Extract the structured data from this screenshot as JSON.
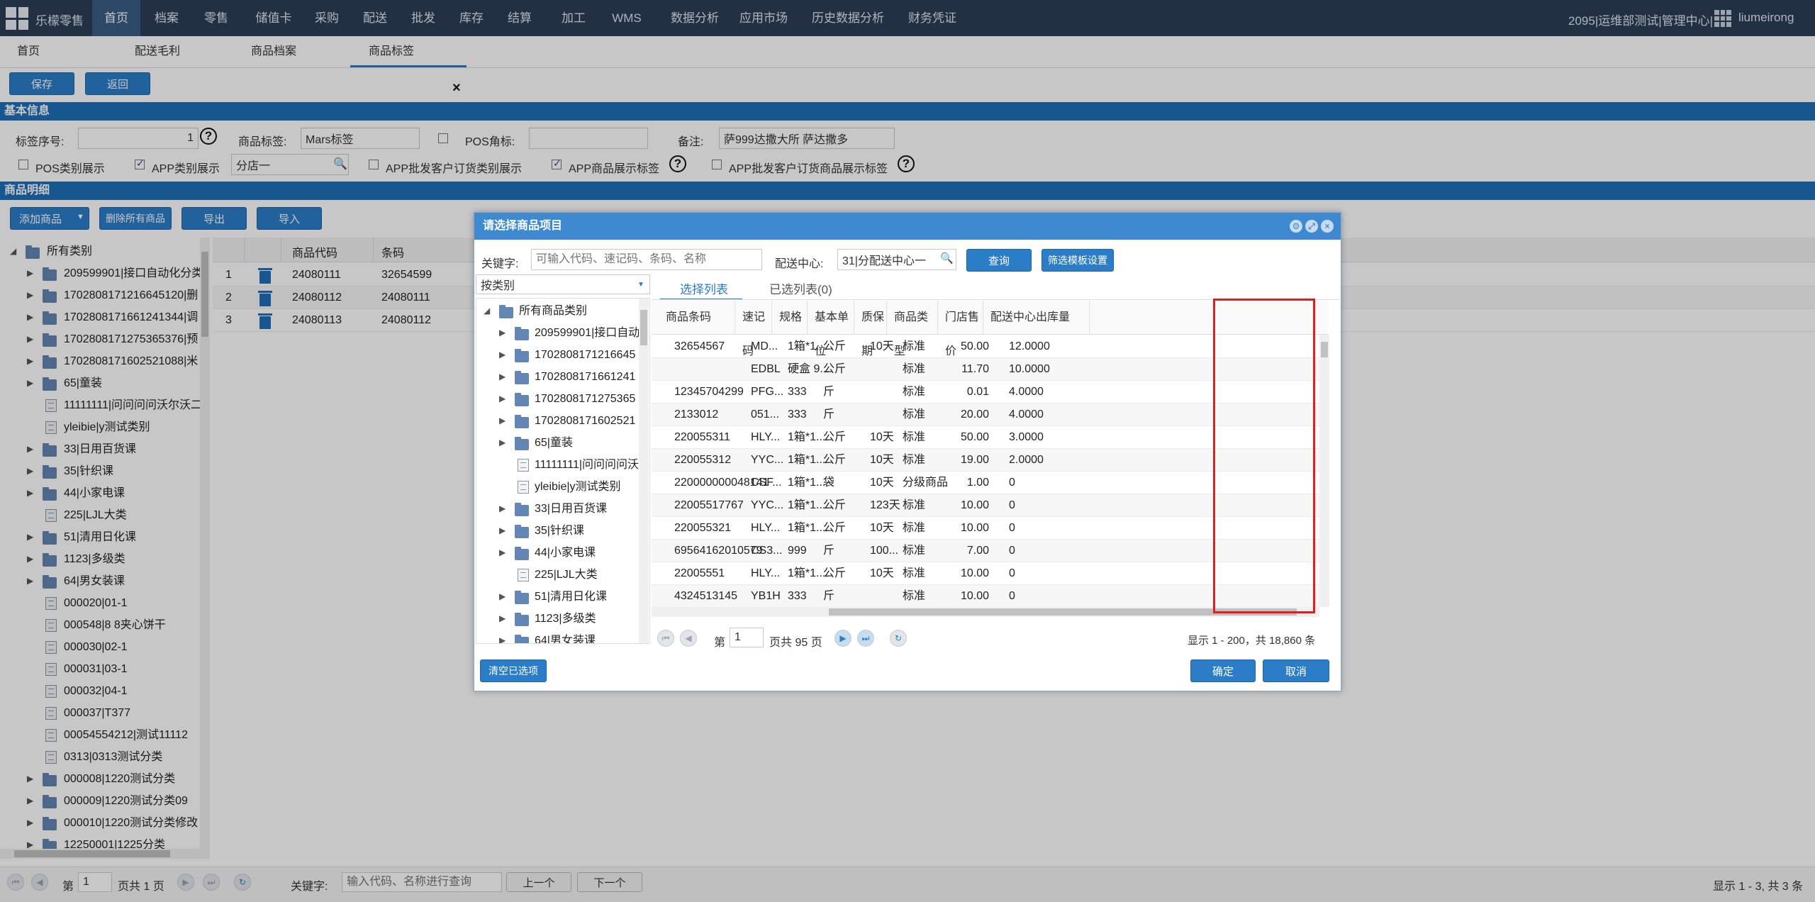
{
  "app": {
    "name": "乐檬零售"
  },
  "nav": [
    "首页",
    "档案",
    "零售",
    "储值卡",
    "采购",
    "配送",
    "批发",
    "库存",
    "结算",
    "加工",
    "WMS",
    "数据分析",
    "应用市场",
    "历史数据分析",
    "财务凭证"
  ],
  "top_right": {
    "org": "2095|运维部测试|管理中心|",
    "user": "liumeirong"
  },
  "tabs": [
    "首页",
    "配送毛利",
    "商品档案",
    "商品标签"
  ],
  "toolbar": {
    "save": "保存",
    "back": "返回"
  },
  "basic_info": {
    "title": "基本信息",
    "seq_label": "标签序号:",
    "seq_value": "1",
    "tag_label": "商品标签:",
    "tag_value": "Mars标签",
    "pos_corner_label": "POS角标:",
    "remark_label": "备注:",
    "remark_value": "萨999达撒大所 萨达撒多",
    "pos_cat_show": "POS类别展示",
    "app_cat_show": "APP类别展示",
    "branch_value": "分店一",
    "app_wholesale_cat": "APP批发客户订货类别展示",
    "app_goods_tag": "APP商品展示标签",
    "app_wholesale_goods_tag": "APP批发客户订货商品展示标签"
  },
  "detail": {
    "title": "商品明细",
    "add": "添加商品",
    "delete_all": "删除所有商品",
    "export": "导出",
    "import": "导入",
    "columns": [
      "商品代码",
      "条码"
    ],
    "rows": [
      {
        "no": "1",
        "code": "24080111",
        "barcode": "32654599"
      },
      {
        "no": "2",
        "code": "24080112",
        "barcode": "24080111"
      },
      {
        "no": "3",
        "code": "24080113",
        "barcode": "24080112"
      }
    ]
  },
  "left_tree": [
    {
      "label": "所有类别",
      "type": "root"
    },
    {
      "label": "209599901|接口自动化分类",
      "type": "folder"
    },
    {
      "label": "1702808171216645120|删",
      "type": "folder"
    },
    {
      "label": "1702808171661241344|调",
      "type": "folder"
    },
    {
      "label": "1702808171275365376|预",
      "type": "folder"
    },
    {
      "label": "1702808171602521088|米",
      "type": "folder"
    },
    {
      "label": "65|童装",
      "type": "folder"
    },
    {
      "label": "11111111|问问问问沃尔沃二",
      "type": "doc"
    },
    {
      "label": "yleibie|y测试类别",
      "type": "doc"
    },
    {
      "label": "33|日用百货课",
      "type": "folder"
    },
    {
      "label": "35|针织课",
      "type": "folder"
    },
    {
      "label": "44|小家电课",
      "type": "folder"
    },
    {
      "label": "225|LJL大类",
      "type": "doc"
    },
    {
      "label": "51|清用日化课",
      "type": "folder"
    },
    {
      "label": "1123|多级类",
      "type": "folder"
    },
    {
      "label": "64|男女装课",
      "type": "folder"
    },
    {
      "label": "000020|01-1",
      "type": "doc"
    },
    {
      "label": "000548|8 8夹心饼干",
      "type": "doc"
    },
    {
      "label": "000030|02-1",
      "type": "doc"
    },
    {
      "label": "000031|03-1",
      "type": "doc"
    },
    {
      "label": "000032|04-1",
      "type": "doc"
    },
    {
      "label": "000037|T377",
      "type": "doc"
    },
    {
      "label": "00054554212|测试11112",
      "type": "doc"
    },
    {
      "label": "0313|0313测试分类",
      "type": "doc"
    },
    {
      "label": "000008|1220测试分类",
      "type": "folder"
    },
    {
      "label": "000009|1220测试分类09",
      "type": "folder"
    },
    {
      "label": "000010|1220测试分类修改",
      "type": "folder"
    },
    {
      "label": "12250001|1225分类",
      "type": "folder"
    }
  ],
  "bottom_pager": {
    "page_label": "第",
    "page_value": "1",
    "total": "页共 1 页",
    "keyword_label": "关键字:",
    "keyword_placeholder": "输入代码、名称进行查询",
    "prev": "上一个",
    "next": "下一个",
    "summary": "显示 1 - 3, 共 3 条"
  },
  "modal": {
    "title": "请选择商品项目",
    "keyword_label": "关键字:",
    "keyword_placeholder": "可输入代码、速记码、条码、名称",
    "dc_label": "配送中心:",
    "dc_value": "31|分配送中心一",
    "query": "查询",
    "filter_template": "筛选模板设置",
    "category_mode": "按类别",
    "tab_select": "选择列表",
    "tab_selected": "已选列表(0)",
    "tree": [
      {
        "label": "所有商品类别",
        "type": "root"
      },
      {
        "label": "209599901|接口自动",
        "type": "folder"
      },
      {
        "label": "1702808171216645",
        "type": "folder"
      },
      {
        "label": "1702808171661241",
        "type": "folder"
      },
      {
        "label": "1702808171275365",
        "type": "folder"
      },
      {
        "label": "1702808171602521",
        "type": "folder"
      },
      {
        "label": "65|童装",
        "type": "folder"
      },
      {
        "label": "11111111|问问问问沃",
        "type": "doc"
      },
      {
        "label": "yleibie|y测试类别",
        "type": "doc"
      },
      {
        "label": "33|日用百货课",
        "type": "folder"
      },
      {
        "label": "35|针织课",
        "type": "folder"
      },
      {
        "label": "44|小家电课",
        "type": "folder"
      },
      {
        "label": "225|LJL大类",
        "type": "doc"
      },
      {
        "label": "51|清用日化课",
        "type": "folder"
      },
      {
        "label": "1123|多级类",
        "type": "folder"
      },
      {
        "label": "64|男女装课",
        "type": "folder"
      }
    ],
    "columns": [
      "商品条码",
      "速记码",
      "规格",
      "基本单位",
      "质保期",
      "商品类型",
      "门店售价",
      "配送中心出库量"
    ],
    "rows": [
      [
        "32654567",
        "MD...",
        "1箱*1...",
        "公斤",
        "10天",
        "标准",
        "50.00",
        "12.0000"
      ],
      [
        "",
        "EDBL",
        "硬盒 9...",
        "公斤",
        "",
        "标准",
        "11.70",
        "10.0000"
      ],
      [
        "12345704299",
        "PFG...",
        "333",
        "斤",
        "",
        "标准",
        "0.01",
        "4.0000"
      ],
      [
        "2133012",
        "051...",
        "333",
        "斤",
        "",
        "标准",
        "20.00",
        "4.0000"
      ],
      [
        "220055311",
        "HLY...",
        "1箱*1...",
        "公斤",
        "10天",
        "标准",
        "50.00",
        "3.0000"
      ],
      [
        "220055312",
        "YYC...",
        "1箱*1...",
        "公斤",
        "10天",
        "标准",
        "19.00",
        "2.0000"
      ],
      [
        "220000000048141...",
        "CSF...",
        "1箱*1...",
        "袋",
        "10天",
        "分级商品",
        "1.00",
        "0"
      ],
      [
        "22005517767",
        "YYC...",
        "1箱*1...",
        "公斤",
        "123天",
        "标准",
        "10.00",
        "0"
      ],
      [
        "220055321",
        "HLY...",
        "1箱*1...",
        "公斤",
        "10天",
        "标准",
        "10.00",
        "0"
      ],
      [
        "69564162010579",
        "CS3...",
        "999",
        "斤",
        "100...",
        "标准",
        "7.00",
        "0"
      ],
      [
        "22005551",
        "HLY...",
        "1箱*1...",
        "公斤",
        "10天",
        "标准",
        "10.00",
        "0"
      ],
      [
        "4324513145",
        "YB1H",
        "333",
        "斤",
        "",
        "标准",
        "10.00",
        "0"
      ]
    ],
    "pager": {
      "page_label": "第",
      "page_value": "1",
      "total": "页共 95 页",
      "summary": "显示 1 - 200，共 18,860 条"
    },
    "clear": "清空已选项",
    "ok": "确定",
    "cancel": "取消"
  }
}
